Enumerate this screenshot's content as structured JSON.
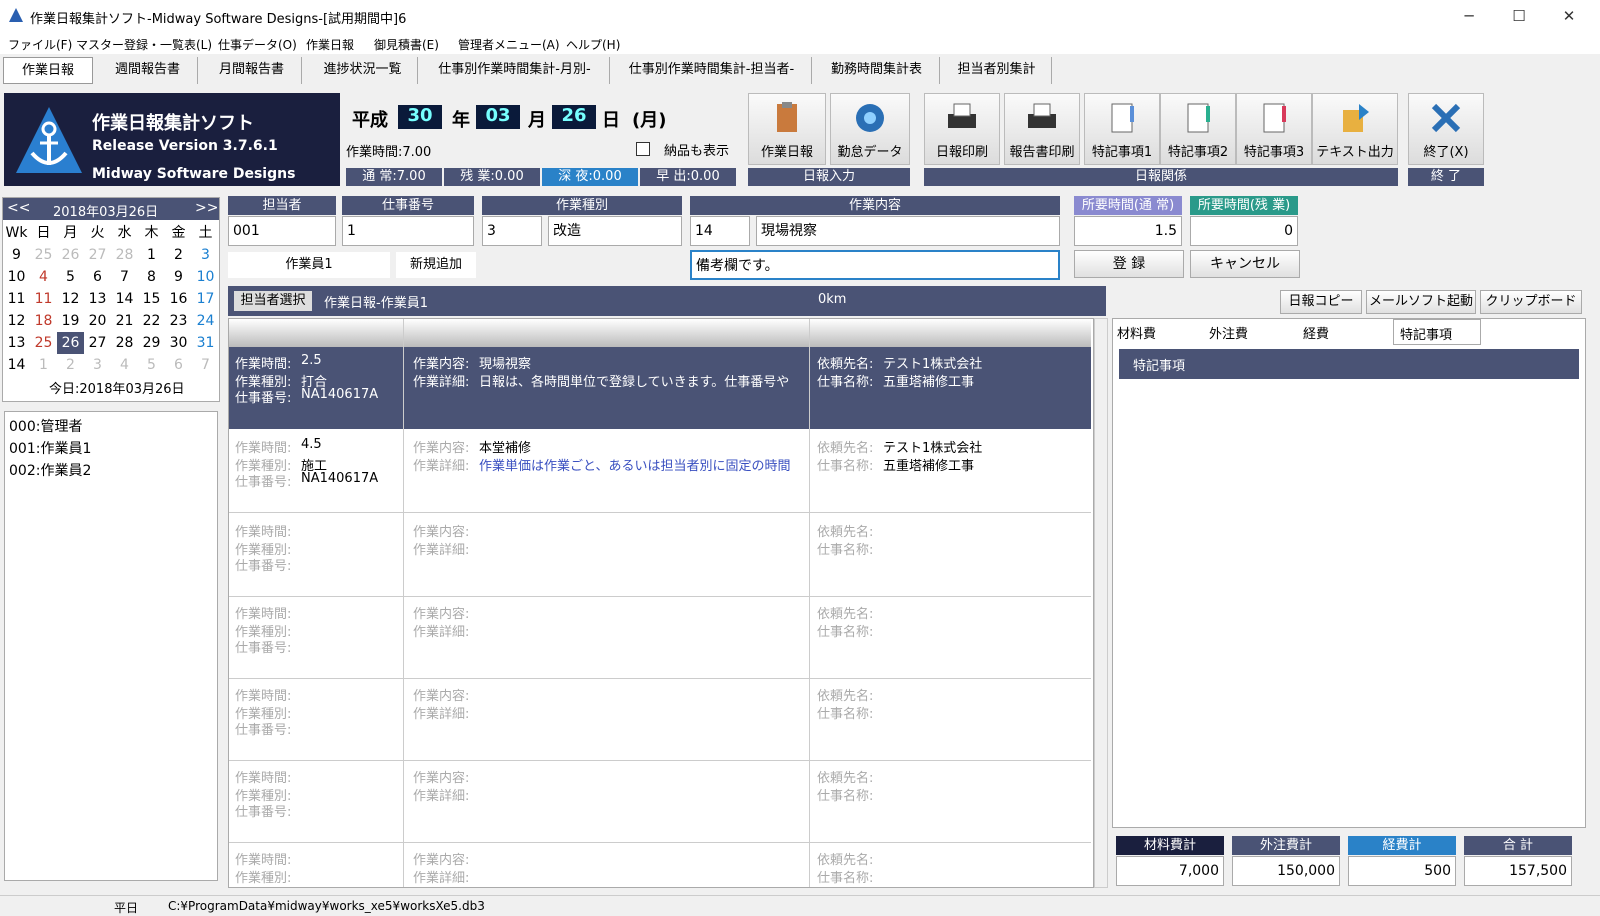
{
  "window": {
    "title": "作業日報集計ソフト-Midway Software Designs-[試用期間中]6"
  },
  "menu": [
    "ファイル(F)",
    "マスター登録・一覧表(L)",
    "仕事データ(O)",
    "作業日報",
    "御見積書(E)",
    "管理者メニュー(A)",
    "ヘルプ(H)"
  ],
  "tabs": [
    "作業日報",
    "週間報告書",
    "月間報告書",
    "進捗状況一覧",
    "仕事別作業時間集計-月別-",
    "仕事別作業時間集計-担当者-",
    "勤務時間集計表",
    "担当者別集計"
  ],
  "logo": {
    "title": "作業日報集計ソフト",
    "version": "Release Version 3.7.6.1",
    "company": "Midway Software Designs"
  },
  "date": {
    "era": "平成",
    "year": "30",
    "year_label": "年",
    "month": "03",
    "month_label": "月",
    "day": "26",
    "day_label": "日",
    "weekday": "(月)"
  },
  "work_time": "作業時間:7.00",
  "show_delivery": "納品も表示",
  "stats": [
    "通 常:7.00",
    "残 業:0.00",
    "深 夜:0.00",
    "早 出:0.00"
  ],
  "toolbar": {
    "nippo": "作業日報",
    "kintai": "勤怠データ",
    "group1": "日報入力",
    "print": "日報印刷",
    "report_print": "報告書印刷",
    "note1": "特記事項1",
    "note2": "特記事項2",
    "note3": "特記事項3",
    "text_out": "テキスト出力",
    "group2": "日報関係",
    "exit": "終了(X)",
    "group3": "終 了"
  },
  "form": {
    "h_person": "担当者",
    "h_job": "仕事番号",
    "h_type": "作業種別",
    "h_content": "作業内容",
    "h_time_normal": "所要時間(通 常)",
    "h_time_over": "所要時間(残 業)",
    "person": "001",
    "job": "1",
    "type_code": "3",
    "type_name": "改造",
    "content_code": "14",
    "content_name": "現場視察",
    "time_normal": "1.5",
    "time_over": "0",
    "person_name": "作業員1",
    "new_add": "新規追加",
    "remarks": "備考欄です。",
    "register": "登 録",
    "cancel": "キャンセル"
  },
  "calendar": {
    "month": "2018年03月26日",
    "prev": "<<",
    "next": ">>",
    "headers": [
      "Wk",
      "日",
      "月",
      "火",
      "水",
      "木",
      "金",
      "土"
    ],
    "rows": [
      [
        "9",
        "25",
        "26",
        "27",
        "28",
        "1",
        "2",
        "3"
      ],
      [
        "10",
        "4",
        "5",
        "6",
        "7",
        "8",
        "9",
        "10"
      ],
      [
        "11",
        "11",
        "12",
        "13",
        "14",
        "15",
        "16",
        "17"
      ],
      [
        "12",
        "18",
        "19",
        "20",
        "21",
        "22",
        "23",
        "24"
      ],
      [
        "13",
        "25",
        "26",
        "27",
        "28",
        "29",
        "30",
        "31"
      ],
      [
        "14",
        "1",
        "2",
        "3",
        "4",
        "5",
        "6",
        "7"
      ]
    ],
    "today": "今日:2018年03月26日"
  },
  "users": [
    "000:管理者",
    "001:作業員1",
    "002:作業員2"
  ],
  "main": {
    "select": "担当者選択",
    "title": "作業日報-作業員1",
    "km": "0km",
    "copy": "日報コピー",
    "mail": "メールソフト起動",
    "clip": "クリップボード"
  },
  "labels": {
    "time": "作業時間:",
    "type": "作業種別:",
    "job": "仕事番号:",
    "content": "作業内容:",
    "detail": "作業詳細:",
    "client": "依頼先名:",
    "name": "仕事名称:"
  },
  "entries": [
    {
      "time": "2.5",
      "type": "打合",
      "job": "NA140617A",
      "content": "現場視察",
      "detail": "日報は、各時間単位で登録していきます。仕事番号や",
      "client": "テスト1株式会社",
      "name": "五重塔補修工事"
    },
    {
      "time": "4.5",
      "type": "施工",
      "job": "NA140617A",
      "content": "本堂補修",
      "detail": "作業単価は作業ごと、あるいは担当者別に固定の時間",
      "client": "テスト1株式会社",
      "name": "五重塔補修工事"
    }
  ],
  "right": {
    "tabs": [
      "材料費",
      "外注費",
      "経費",
      "特記事項"
    ],
    "header": "特記事項",
    "totals_labels": [
      "材料費計",
      "外注費計",
      "経費計",
      "合 計"
    ],
    "totals": [
      "7,000",
      "150,000",
      "500",
      "157,500"
    ]
  },
  "status": {
    "day": "平日",
    "path": "C:¥ProgramData¥midway¥works_xe5¥worksXe5.db3"
  }
}
